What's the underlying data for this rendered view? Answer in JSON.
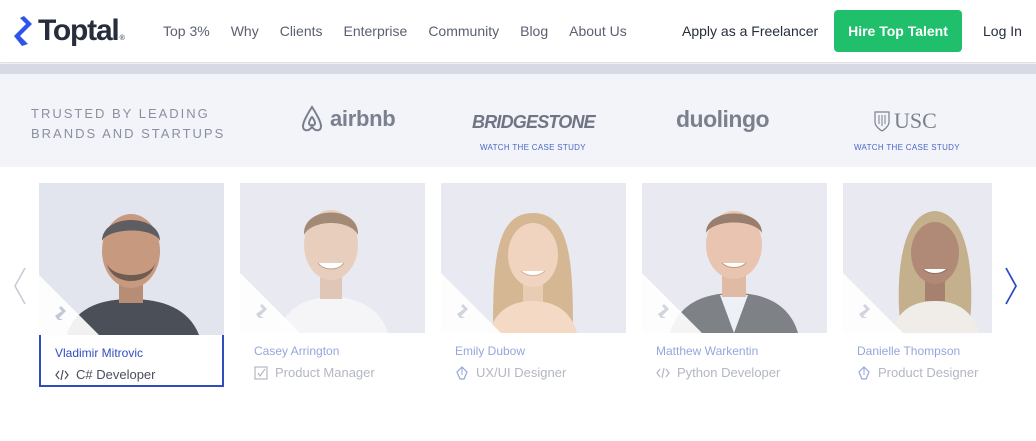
{
  "header": {
    "logo_text": "Toptal",
    "logo_reg": "®",
    "nav": [
      "Top 3%",
      "Why",
      "Clients",
      "Enterprise",
      "Community",
      "Blog",
      "About Us"
    ],
    "apply": "Apply as a Freelancer",
    "hire": "Hire Top Talent",
    "login": "Log In",
    "accent_color": "#20bf6b"
  },
  "trusted": {
    "label": "TRUSTED BY LEADING BRANDS AND STARTUPS",
    "brands": [
      {
        "name": "airbnb",
        "case_study": ""
      },
      {
        "name": "BRIDGESTONE",
        "case_study": "WATCH THE CASE STUDY"
      },
      {
        "name": "duolingo",
        "case_study": ""
      },
      {
        "name": "USC",
        "case_study": "WATCH THE CASE STUDY"
      }
    ]
  },
  "carousel": {
    "cards": [
      {
        "name": "Vladimir Mitrovic",
        "role": "C# Developer",
        "role_icon": "code-icon",
        "active": true
      },
      {
        "name": "Casey Arrington",
        "role": "Product Manager",
        "role_icon": "checkbox-icon",
        "active": false
      },
      {
        "name": "Emily Dubow",
        "role": "UX/UI Designer",
        "role_icon": "pen-icon",
        "active": false
      },
      {
        "name": "Matthew Warkentin",
        "role": "Python Developer",
        "role_icon": "code-icon",
        "active": false
      },
      {
        "name": "Danielle Thompson",
        "role": "Product Designer",
        "role_icon": "pen-icon",
        "active": false
      }
    ],
    "prev_icon": "chevron-left-icon",
    "next_icon": "chevron-right-icon"
  }
}
